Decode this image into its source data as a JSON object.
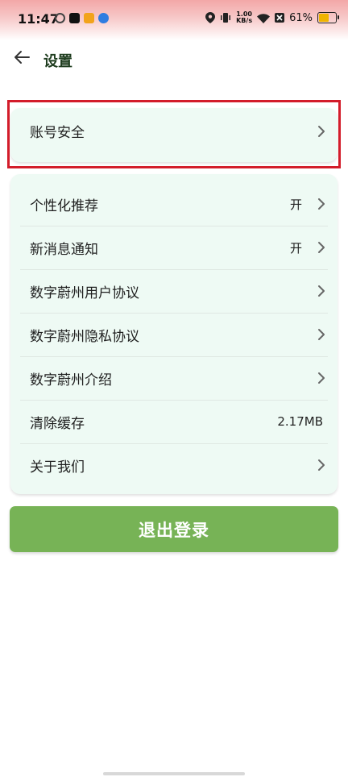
{
  "status_bar": {
    "time": "11:47",
    "net_speed_value": "1.00",
    "net_speed_unit": "KB/s",
    "battery": "61%"
  },
  "header": {
    "title": "设置"
  },
  "account_card": {
    "items": [
      {
        "label": "账号安全",
        "value": ""
      }
    ]
  },
  "settings_card": {
    "items": [
      {
        "label": "个性化推荐",
        "value": "开"
      },
      {
        "label": "新消息通知",
        "value": "开"
      },
      {
        "label": "数字蔚州用户协议",
        "value": ""
      },
      {
        "label": "数字蔚州隐私协议",
        "value": ""
      },
      {
        "label": "数字蔚州介绍",
        "value": ""
      },
      {
        "label": "清除缓存",
        "value": "2.17MB"
      },
      {
        "label": "关于我们",
        "value": ""
      }
    ]
  },
  "logout_label": "退出登录",
  "colors": {
    "accent": "#77b356",
    "card_bg": "#eefaf4",
    "highlight": "#d31c2a"
  }
}
